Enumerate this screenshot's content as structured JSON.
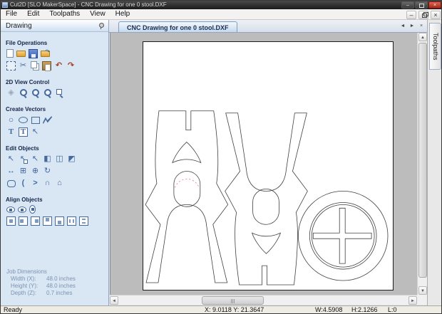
{
  "window": {
    "title": "Cut2D [SLO MakerSpace] - CNC Drawing for one 0 stool.DXF",
    "controls": {
      "minimize": "–",
      "close": "×"
    }
  },
  "menu": {
    "items": [
      {
        "name": "file",
        "label": "File"
      },
      {
        "name": "edit",
        "label": "Edit"
      },
      {
        "name": "toolpaths",
        "label": "Toolpaths"
      },
      {
        "name": "view",
        "label": "View"
      },
      {
        "name": "help",
        "label": "Help"
      }
    ]
  },
  "mdi_controls": {
    "minimize": "–",
    "close": "×"
  },
  "sidebar": {
    "header": {
      "title": "Drawing"
    },
    "sections": [
      {
        "title": "File Operations",
        "rows": [
          [
            "new-file",
            "open-file",
            "save-file",
            "import-vectors"
          ],
          [
            "job-setup",
            "cut",
            "copy",
            "paste",
            "undo",
            "redo"
          ]
        ]
      },
      {
        "title": "2D View Control",
        "rows": [
          [
            "pan-view",
            "zoom-interactive",
            "zoom-box",
            "zoom-selected",
            "zoom-drawing"
          ]
        ]
      },
      {
        "title": "Create Vectors",
        "rows": [
          [
            "draw-circle",
            "draw-ellipse",
            "draw-rectangle",
            "draw-polyline"
          ],
          [
            "draw-text",
            "draw-text-in-box",
            "select-text-tool"
          ]
        ]
      },
      {
        "title": "Edit Objects",
        "rows": [
          [
            "select-tool",
            "node-edit-tool",
            "interactive-selection",
            "mirror-tool",
            "measure-tool",
            "distort-tool"
          ],
          [
            "scale-tool",
            "set-size-tool",
            "move-tool",
            "rotate-tool"
          ],
          [
            "fillet-tool",
            "arc-fit",
            "span-edit",
            "join-vectors",
            "weld-vectors"
          ]
        ]
      },
      {
        "title": "Align Objects",
        "rows": [
          [
            "center-in-material",
            "align-horizontal",
            "align-vertical"
          ],
          [
            "align-center",
            "align-left",
            "align-right",
            "align-top",
            "align-bottom",
            "space-horizontal",
            "space-vertical"
          ]
        ]
      }
    ],
    "icon_glyphs": {
      "cut": "✂",
      "undo": "↶",
      "redo": "↷",
      "pan-view": "◈",
      "draw-circle": "○",
      "draw-text": "T",
      "draw-text-in-box": "T",
      "select-text-tool": "↖",
      "select-tool": "↖",
      "node-edit-tool": "↖",
      "interactive-selection": "↖",
      "mirror-tool": "◧",
      "measure-tool": "◫",
      "distort-tool": "◩",
      "scale-tool": "↔",
      "set-size-tool": "⊞",
      "move-tool": "⊕",
      "rotate-tool": "↻",
      "arc-fit": "(",
      "span-edit": ">",
      "join-vectors": "∩",
      "weld-vectors": "⌂"
    },
    "job_dimensions": {
      "title": "Job Dimensions",
      "rows": [
        {
          "label": "Width  (X):",
          "value": "48.0 inches"
        },
        {
          "label": "Height (Y):",
          "value": "48.0 inches"
        },
        {
          "label": "Depth  (Z):",
          "value": "0.7 inches"
        }
      ]
    }
  },
  "document": {
    "tab": {
      "label": "CNC Drawing for one 0 stool.DXF"
    },
    "tab_nav": {
      "prev": "◄",
      "next": "►",
      "close": "×"
    },
    "right_tab": {
      "label": "Toolpaths"
    },
    "scrollbars": {
      "up": "▲",
      "down": "▼",
      "left": "◄",
      "right": "►"
    }
  },
  "drawing": {
    "parts": [
      "stool-side-panel-upright",
      "stool-side-panel-rotated-180",
      "stool-seat-disc-with-cross-slot"
    ],
    "selection_indicator": "pink-dashed-arc-on-oval-cutout"
  },
  "statusbar": {
    "ready": "Ready",
    "cursor_position": "X: 9.0118 Y: 21.3647",
    "width": "W:4.5908",
    "height": "H:2.1266",
    "length": "L:0"
  },
  "colors": {
    "titlebar": "#2b2b2b",
    "close_button": "#b5301f",
    "sidebar_bg": "#d9e6f4",
    "active_tab": "#cfe0f2",
    "canvas_gray": "#bcbcbc",
    "vector_outline": "#3f3f3f",
    "selection_pink": "#e06ab0"
  }
}
